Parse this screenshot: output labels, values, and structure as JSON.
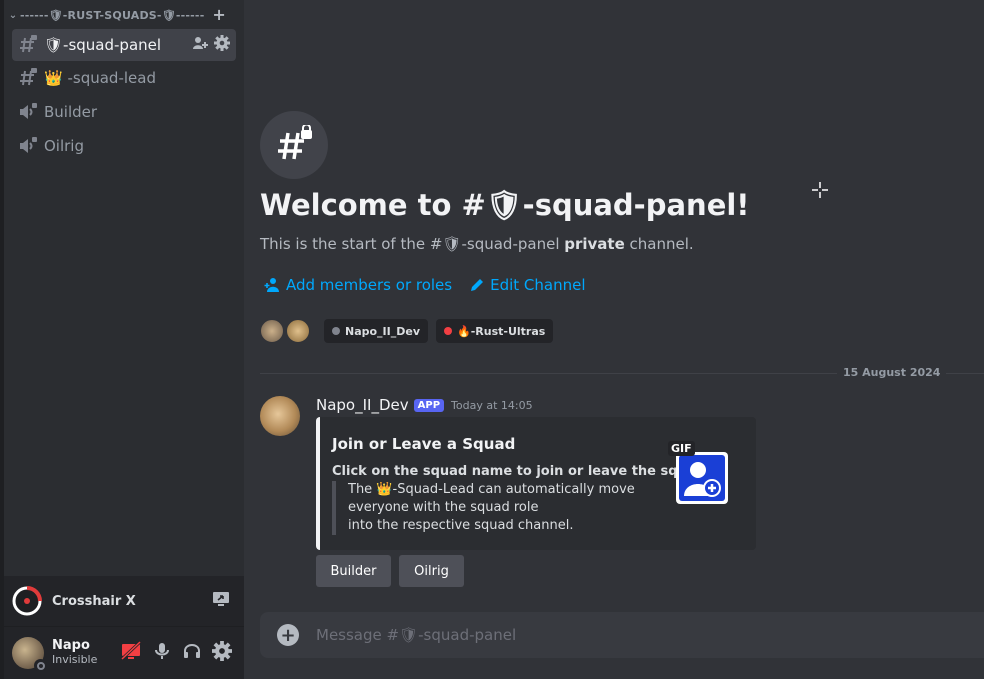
{
  "sidebar": {
    "category": "------🛡-RUST-SQUADS-🛡------",
    "channels": [
      {
        "label": "🛡-squad-panel",
        "type": "text-locked",
        "active": true
      },
      {
        "label": "-squad-lead",
        "type": "text-locked",
        "emoji": "👑",
        "active": false
      },
      {
        "label": "Builder",
        "type": "voice-locked",
        "active": false
      },
      {
        "label": "Oilrig",
        "type": "voice-locked",
        "active": false
      }
    ],
    "activity_app": {
      "name": "Crosshair X"
    },
    "user": {
      "name": "Napo",
      "status": "Invisible"
    }
  },
  "main": {
    "welcome_title": "Welcome to #🛡-squad-panel!",
    "intro_prefix": "This is the start of the #🛡-squad-panel ",
    "intro_bold": "private",
    "intro_suffix": " channel.",
    "add_members": "Add members or roles",
    "edit_channel": "Edit Channel",
    "chips": [
      {
        "label": "Napo_II_Dev",
        "dot_color": "#80848e"
      },
      {
        "label": "🔥-Rust-Ultras",
        "dot_color": "#f23f43"
      }
    ],
    "date_divider": "15 August 2024",
    "message": {
      "author": "Napo_II_Dev",
      "badge": "APP",
      "time": "Today at 14:05",
      "embed": {
        "title": "Join or Leave a Squad",
        "description": "Click on the squad name to join or leave the squad.",
        "quote_lines": [
          "The 👑-Squad-Lead can automatically move",
          "everyone with the squad role",
          "into the respective squad channel."
        ],
        "gif_label": "GIF"
      },
      "buttons": [
        "Builder",
        "Oilrig"
      ]
    },
    "composer_placeholder": "Message #🛡-squad-panel"
  },
  "colors": {
    "link": "#00a8fc",
    "app_badge": "#5865f2",
    "active_channel": "#404249",
    "muted_red": "#f23f43"
  }
}
